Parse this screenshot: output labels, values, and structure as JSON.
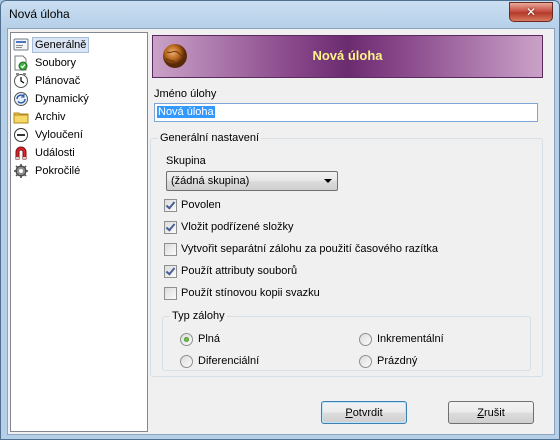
{
  "window": {
    "title": "Nová úloha",
    "close_glyph": "✕"
  },
  "nav": {
    "items": [
      {
        "label": "Generálně",
        "icon": "general-icon",
        "selected": true
      },
      {
        "label": "Soubory",
        "icon": "files-icon"
      },
      {
        "label": "Plánovač",
        "icon": "scheduler-icon"
      },
      {
        "label": "Dynamický",
        "icon": "dynamic-icon"
      },
      {
        "label": "Archiv",
        "icon": "archive-icon"
      },
      {
        "label": "Vyloučení",
        "icon": "exclusion-icon"
      },
      {
        "label": "Události",
        "icon": "events-icon"
      },
      {
        "label": "Pokročilé",
        "icon": "advanced-icon"
      }
    ]
  },
  "banner": {
    "title": "Nová úloha",
    "icon": "globe-icon"
  },
  "task_name": {
    "label": "Jméno úlohy",
    "value": "Nová úloha"
  },
  "general_settings": {
    "legend": "Generální nastavení",
    "group_label": "Skupina",
    "group_value": "(žádná skupina)",
    "checkboxes": [
      {
        "label": "Povolen",
        "checked": true
      },
      {
        "label": "Vložit podřízené složky",
        "checked": true
      },
      {
        "label": "Vytvořit separátní zálohu za použití časového razítka",
        "checked": false
      },
      {
        "label": "Použít attributy souborů",
        "checked": true
      },
      {
        "label": "Použít stínovou kopii svazku",
        "checked": false
      }
    ]
  },
  "backup_type": {
    "legend": "Typ zálohy",
    "options": [
      {
        "label": "Plná",
        "checked": true
      },
      {
        "label": "Inkrementální",
        "checked": false
      },
      {
        "label": "Diferenciální",
        "checked": false
      },
      {
        "label": "Prázdný",
        "checked": false
      }
    ]
  },
  "buttons": {
    "confirm_first": "P",
    "confirm_rest": "otvrdit",
    "cancel_first": "Z",
    "cancel_rest": "rušit"
  },
  "colors": {
    "banner_text": "#fff38a",
    "selection": "#3399ff"
  }
}
